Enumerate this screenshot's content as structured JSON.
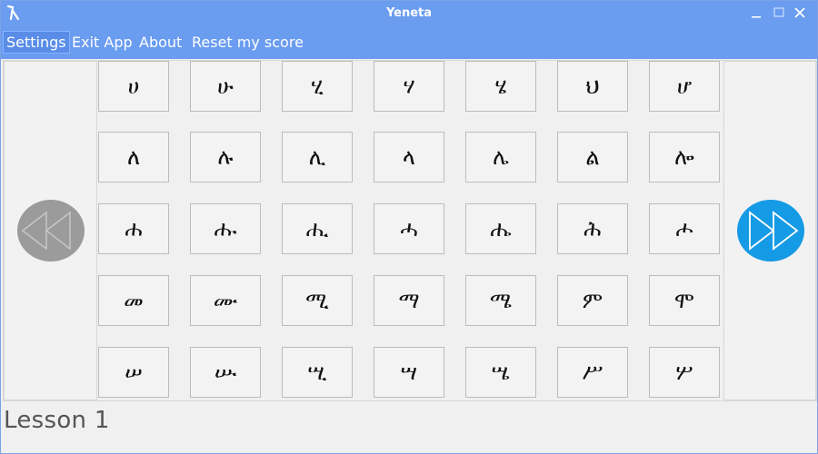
{
  "window": {
    "title": "Yeneta",
    "controls": [
      "minimize-icon",
      "maximize-icon",
      "close-icon"
    ]
  },
  "menu": {
    "items": [
      {
        "label": "Settings",
        "selected": true
      },
      {
        "label": "Exit App",
        "selected": false
      },
      {
        "label": "About",
        "selected": false
      },
      {
        "label": "Reset my score",
        "selected": false
      }
    ]
  },
  "nav": {
    "prev_icon": "rewind-icon",
    "next_icon": "fast-forward-icon",
    "prev_color": "#9b9b9b",
    "next_color": "#159ae5"
  },
  "grid": {
    "rows": [
      [
        "ሀ",
        "ሁ",
        "ሂ",
        "ሃ",
        "ሄ",
        "ህ",
        "ሆ"
      ],
      [
        "ለ",
        "ሉ",
        "ሊ",
        "ላ",
        "ሌ",
        "ል",
        "ሎ"
      ],
      [
        "ሐ",
        "ሑ",
        "ሒ",
        "ሓ",
        "ሔ",
        "ሕ",
        "ሖ"
      ],
      [
        "መ",
        "ሙ",
        "ሚ",
        "ማ",
        "ሜ",
        "ም",
        "ሞ"
      ],
      [
        "ሠ",
        "ሡ",
        "ሢ",
        "ሣ",
        "ሤ",
        "ሥ",
        "ሦ"
      ]
    ]
  },
  "status": {
    "lesson_label": "Lesson 1"
  },
  "colors": {
    "accent": "#6a9cf0"
  }
}
